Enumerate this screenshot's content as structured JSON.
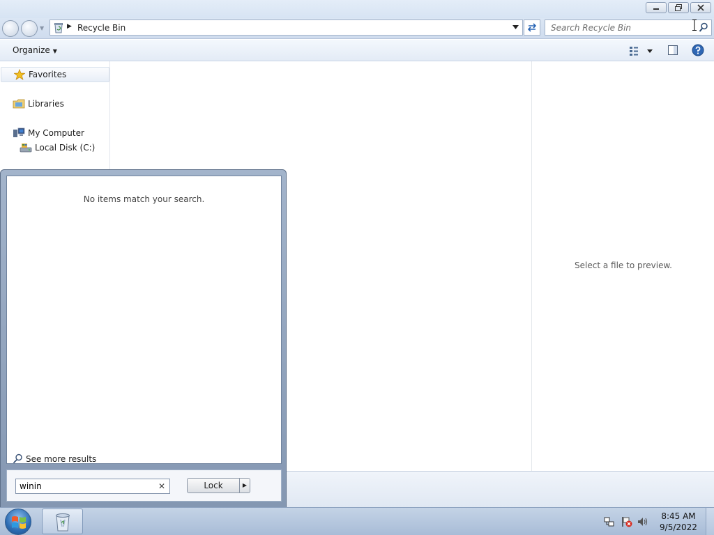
{
  "window": {
    "address": {
      "location_label": "Recycle Bin",
      "location_icon": "recycle-bin-icon"
    },
    "search": {
      "placeholder": "Search Recycle Bin"
    },
    "toolbar": {
      "organize_label": "Organize"
    },
    "navigation_pane": {
      "items": [
        {
          "label": "Favorites",
          "icon": "star-icon"
        },
        {
          "label": "Libraries",
          "icon": "libraries-icon"
        },
        {
          "label": "My Computer",
          "icon": "computer-icon"
        },
        {
          "label": "Local Disk (C:)",
          "icon": "drive-icon"
        }
      ]
    },
    "preview_pane": {
      "message": "Select a file to preview."
    }
  },
  "start_menu": {
    "no_results_message": "No items match your search.",
    "see_more_label": "See more results",
    "search_value": "winin",
    "power_button_label": "Lock"
  },
  "taskbar": {
    "pinned": [
      {
        "icon": "recycle-bin-icon"
      }
    ],
    "tray_icons": [
      "network-icon",
      "action-center-flag-icon",
      "volume-icon"
    ],
    "clock": {
      "time": "8:45 AM",
      "date": "9/5/2022"
    }
  },
  "colors": {
    "titlebar": "#dbe6f4",
    "startmenu_frame": "#95a8c2",
    "taskbar": "#b6c8df",
    "start_orb": "#2c6cb3"
  }
}
